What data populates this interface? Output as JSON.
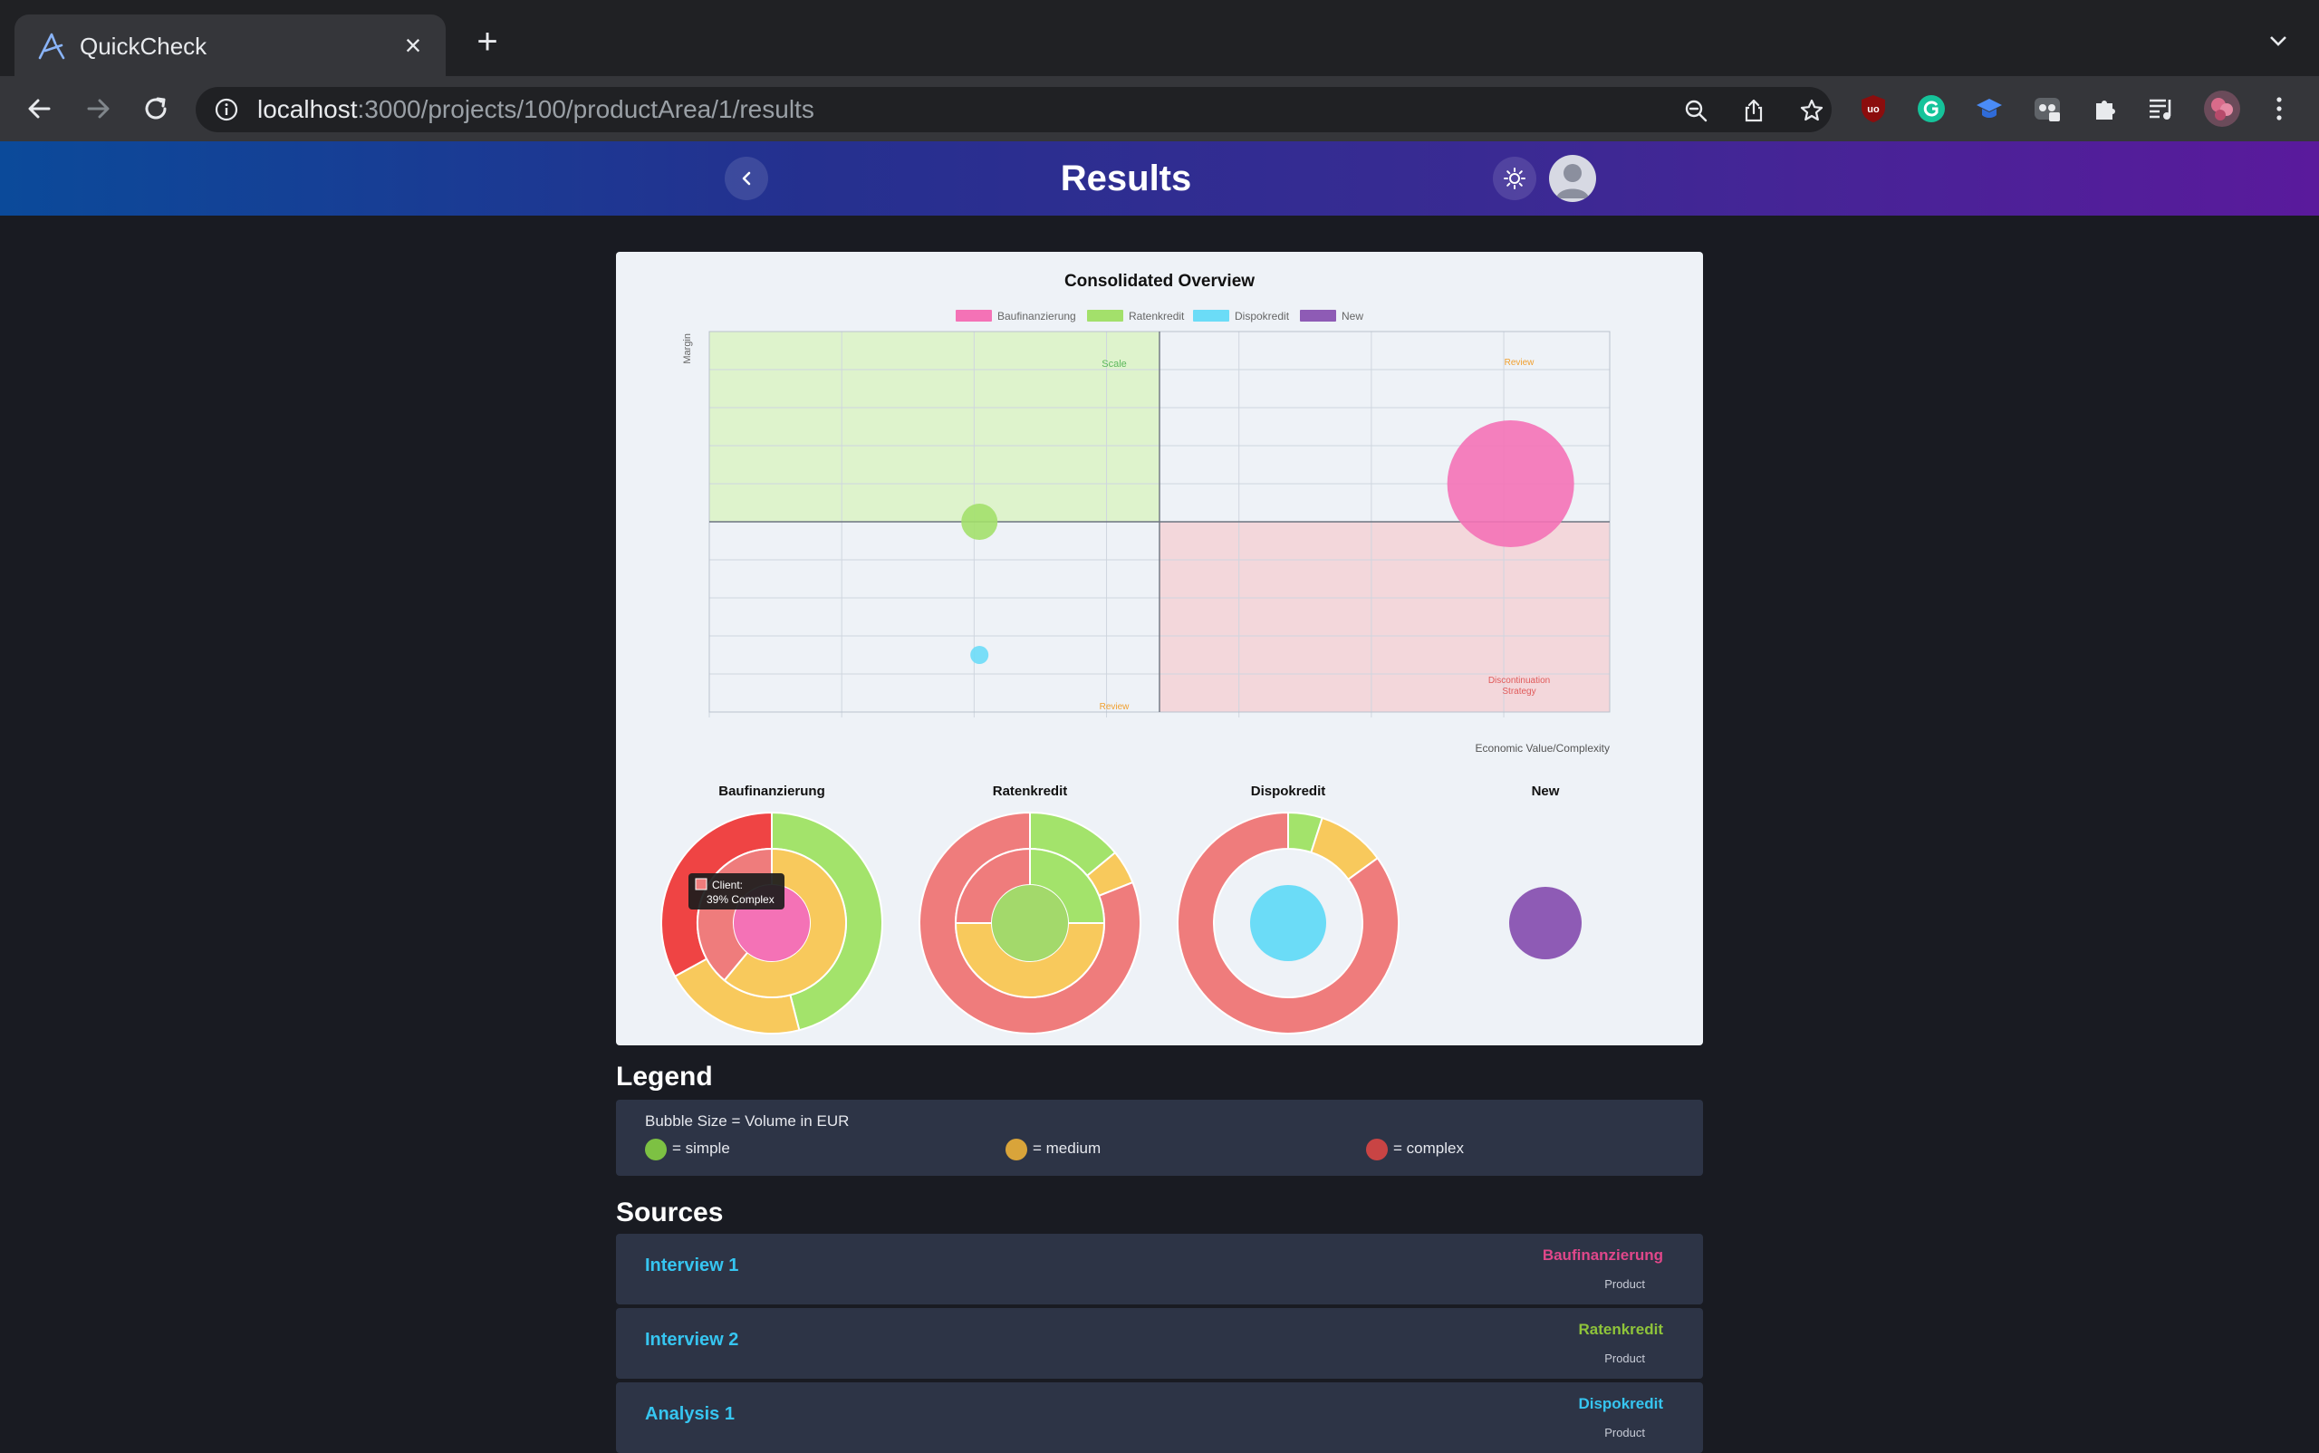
{
  "browser": {
    "tab_title": "QuickCheck",
    "url_host": "localhost",
    "url_path": ":3000/projects/100/productArea/1/results"
  },
  "header": {
    "title": "Results"
  },
  "chart_data": [
    {
      "type": "scatter",
      "title": "Consolidated Overview",
      "xlabel": "Economic Value/Complexity",
      "ylabel": "Margin",
      "grid": true,
      "legend_position": "top",
      "series": [
        {
          "name": "Baufinanzierung",
          "color": "#f472b6",
          "x": 0.89,
          "y": 0.6,
          "size": "large"
        },
        {
          "name": "Ratenkredit",
          "color": "#a3e06b",
          "x": 0.3,
          "y": 0.5,
          "size": "small"
        },
        {
          "name": "Dispokredit",
          "color": "#6bdcf7",
          "x": 0.3,
          "y": 0.15,
          "size": "tiny"
        },
        {
          "name": "New",
          "color": "#8e5bb5",
          "x": null,
          "y": null,
          "size": null
        }
      ],
      "quadrants": [
        {
          "label": "Scale",
          "color": "#5cb85c"
        },
        {
          "label": "Review",
          "color": "#f0a030"
        },
        {
          "label": "Review",
          "color": "#f0a030"
        },
        {
          "label": "Discontinuation Strategy",
          "color": "#e05a5a"
        }
      ]
    },
    {
      "type": "pie",
      "title": "Baufinanzierung",
      "rings": [
        {
          "name": "outer",
          "slices": [
            {
              "label": "simple",
              "value": 46,
              "color": "#a3e36b"
            },
            {
              "label": "medium",
              "value": 21,
              "color": "#f8c95c"
            },
            {
              "label": "complex",
              "value": 33,
              "color": "#ef4444"
            }
          ]
        },
        {
          "name": "Client",
          "slices": [
            {
              "label": "simple",
              "value": 0,
              "color": "#a3e36b"
            },
            {
              "label": "medium",
              "value": 61,
              "color": "#f8c95c"
            },
            {
              "label": "complex",
              "value": 39,
              "color": "#ef7c7c"
            }
          ]
        },
        {
          "name": "center",
          "slices": [
            {
              "label": "Baufinanzierung",
              "value": 100,
              "color": "#f472b6"
            }
          ]
        }
      ],
      "tooltip": {
        "title": "Client:",
        "text": "39% Complex"
      }
    },
    {
      "type": "pie",
      "title": "Ratenkredit",
      "rings": [
        {
          "name": "outer",
          "slices": [
            {
              "label": "simple",
              "value": 14,
              "color": "#a3e36b"
            },
            {
              "label": "medium",
              "value": 5,
              "color": "#f8c95c"
            },
            {
              "label": "complex",
              "value": 81,
              "color": "#ef7c7c"
            }
          ]
        },
        {
          "name": "inner",
          "slices": [
            {
              "label": "simple",
              "value": 25,
              "color": "#a3e36b"
            },
            {
              "label": "medium",
              "value": 50,
              "color": "#f8c95c"
            },
            {
              "label": "complex",
              "value": 25,
              "color": "#ef7c7c"
            }
          ]
        },
        {
          "name": "center",
          "slices": [
            {
              "label": "Ratenkredit",
              "value": 100,
              "color": "#a3d96b"
            }
          ]
        }
      ]
    },
    {
      "type": "pie",
      "title": "Dispokredit",
      "rings": [
        {
          "name": "outer",
          "slices": [
            {
              "label": "simple",
              "value": 5,
              "color": "#a3e36b"
            },
            {
              "label": "medium",
              "value": 10,
              "color": "#f8c95c"
            },
            {
              "label": "complex",
              "value": 85,
              "color": "#ef7c7c"
            }
          ]
        },
        {
          "name": "center",
          "slices": [
            {
              "label": "Dispokredit",
              "value": 100,
              "color": "#6bdcf7"
            }
          ]
        }
      ]
    },
    {
      "type": "pie",
      "title": "New",
      "rings": [
        {
          "name": "center",
          "slices": [
            {
              "label": "New",
              "value": 100,
              "color": "#8e5bb5"
            }
          ]
        }
      ]
    }
  ],
  "legend": {
    "title": "Legend",
    "caption": "Bubble Size = Volume in EUR",
    "items": [
      {
        "label": "= simple",
        "color": "#7dc143"
      },
      {
        "label": "= medium",
        "color": "#d9a43a"
      },
      {
        "label": "= complex",
        "color": "#c94444"
      }
    ]
  },
  "sources": {
    "title": "Sources",
    "rows": [
      {
        "name": "Interview 1",
        "product": "Baufinanzierung",
        "product_color": "#e0478a",
        "sub": "Product"
      },
      {
        "name": "Interview 2",
        "product": "Ratenkredit",
        "product_color": "#8fc43a",
        "sub": "Product"
      },
      {
        "name": "Analysis 1",
        "product": "Dispokredit",
        "product_color": "#36c5f0",
        "sub": "Product"
      }
    ]
  }
}
